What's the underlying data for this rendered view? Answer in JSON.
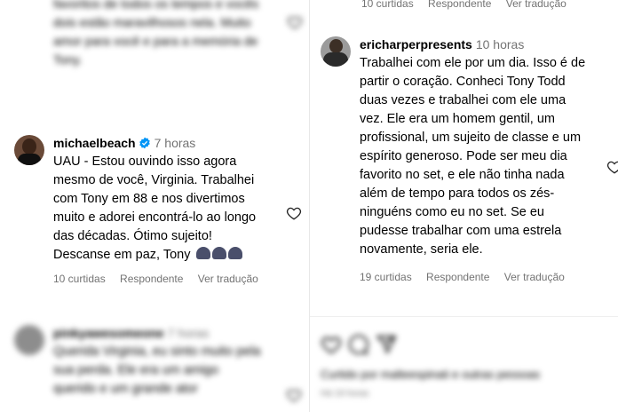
{
  "left": {
    "top_blurred_text": "favoritos de todos os tempos e vocês dois estão maravilhosos nela. Muito amor para você e para a memória de Tony.",
    "michael": {
      "username": "michaelbeach",
      "time": "7 horas",
      "text": "UAU - Estou ouvindo isso agora mesmo de você, Virginia. Trabalhei com Tony em 88 e nos divertimos muito e adorei encontrá-lo ao longo das décadas. Ótimo sujeito! Descanse em paz, Tony",
      "likes": "10 curtidas",
      "reply": "Respondente",
      "translate": "Ver tradução"
    },
    "bottom_blurred": {
      "username": "pinkyawesomeone",
      "time": "7 horas",
      "text": "Querida Virginia, eu sinto muito pela sua perda. Ele era um amigo querido e um grande ator"
    }
  },
  "right": {
    "top_meta": {
      "likes": "10 curtidas",
      "reply": "Respondente",
      "translate": "Ver tradução"
    },
    "eric": {
      "username": "ericharperpresents",
      "time": "10 horas",
      "text": "Trabalhei com ele por um dia. Isso é de partir o coração. Conheci Tony Todd duas vezes e trabalhei com ele uma vez. Ele era um homem gentil, um profissional, um sujeito de classe e um espírito generoso. Pode ser meu dia favorito no set, e ele não tinha nada além de tempo para todos os zés-ninguéns como eu no set. Se eu pudesse trabalhar com uma estrela novamente, seria ele.",
      "likes": "19 curtidas",
      "reply": "Respondente",
      "translate": "Ver tradução"
    },
    "liked_by": "Curtido por malteespinati e outras pessoas",
    "date": "Há 19 horas"
  },
  "colors": {
    "verified": "#0095f6",
    "secondary_text": "#737373",
    "pray_emoji": "#4a4f6b"
  }
}
